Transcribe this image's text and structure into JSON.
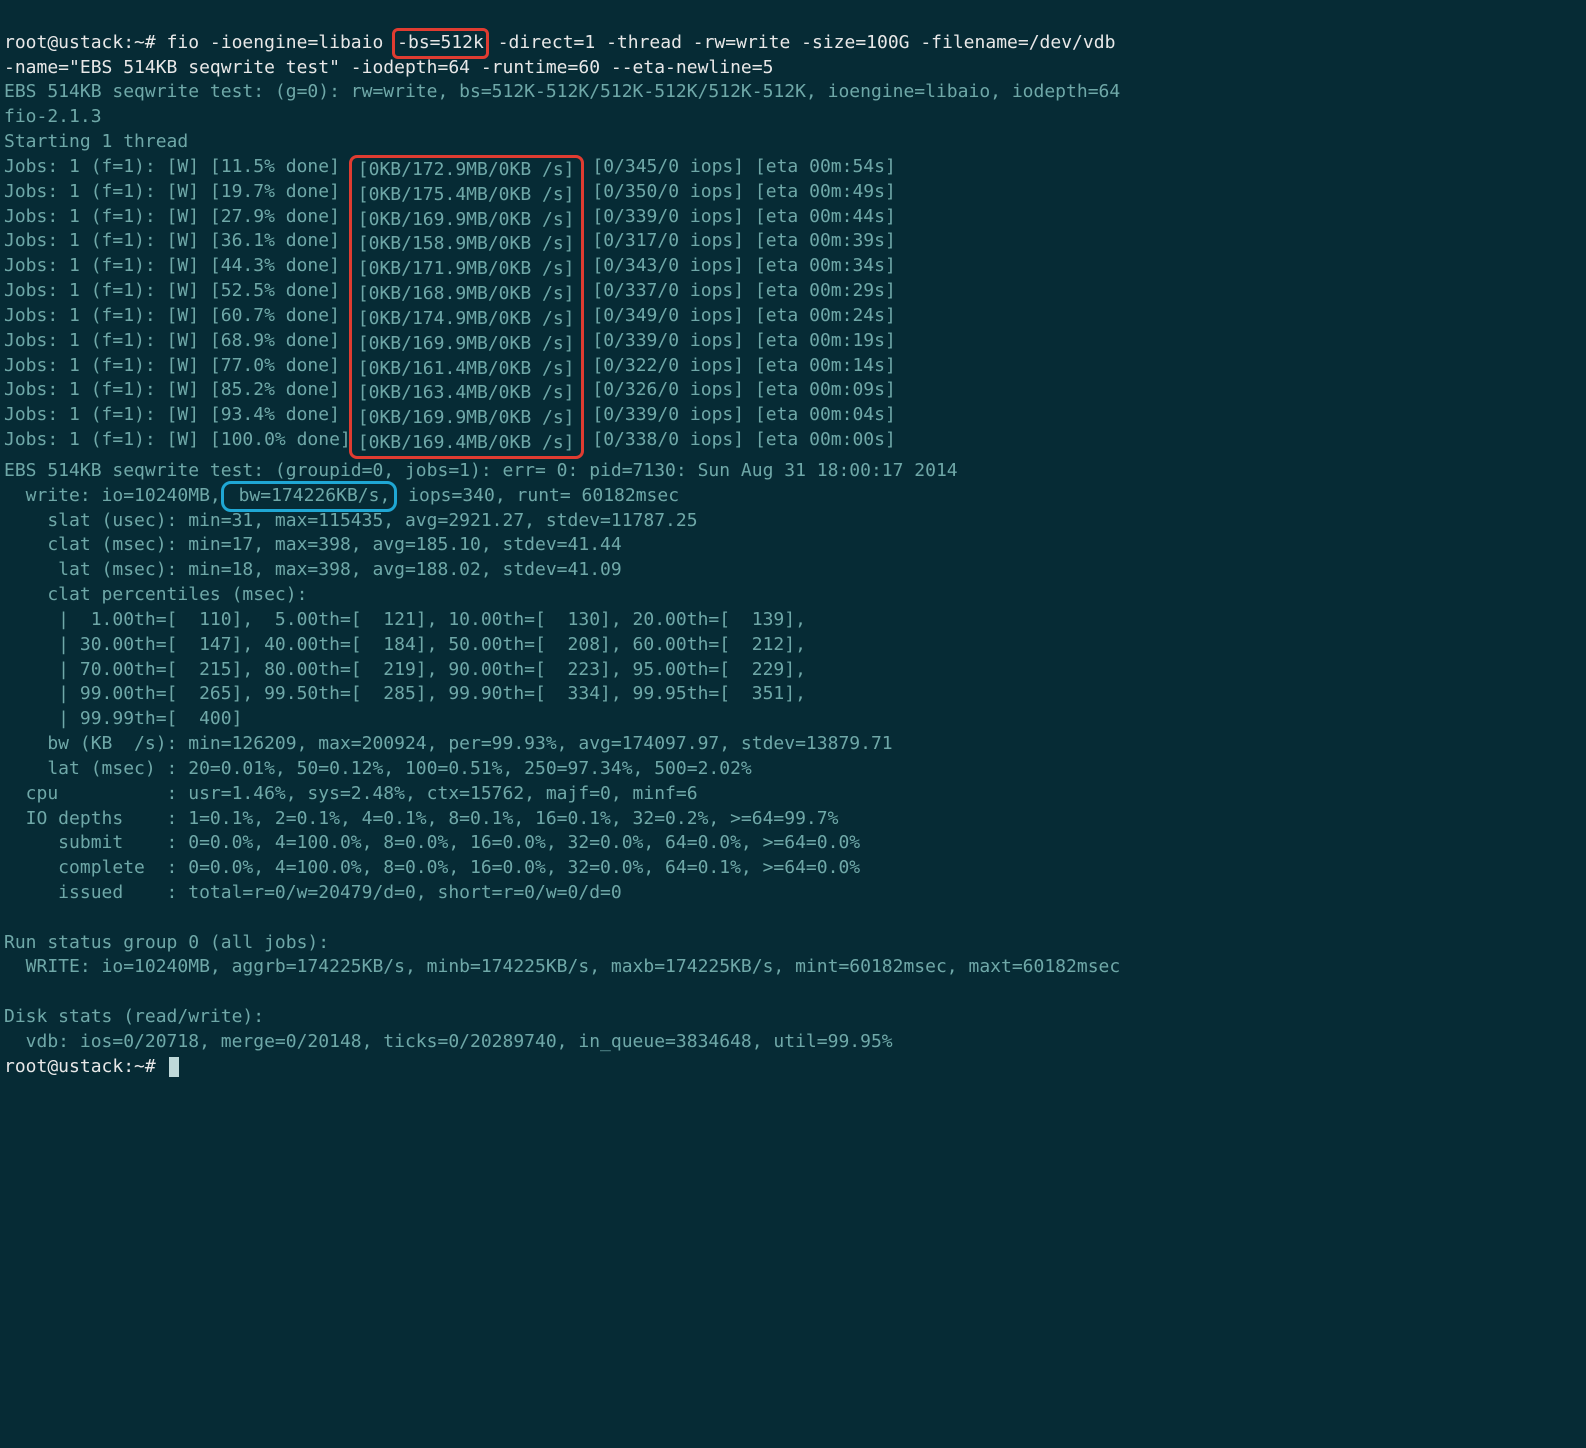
{
  "prompt1_user": "root@ustack",
  "prompt1_sep": ":~# ",
  "cmd_l1_a": "fio -ioengine=libaio ",
  "cmd_hl_bs": "-bs=512k",
  "cmd_l1_b": " -direct=1 -thread -rw=write -size=100G -filename=/dev/vdb",
  "cmd_l2": "-name=\"EBS 514KB seqwrite test\" -iodepth=64 -runtime=60 --eta-newline=5",
  "hdr1": "EBS 514KB seqwrite test: (g=0): rw=write, bs=512K-512K/512K-512K/512K-512K, ioengine=libaio, iodepth=64",
  "hdr2": "fio-2.1.3",
  "hdr3": "Starting 1 thread",
  "jobs": [
    {
      "left": "Jobs: 1 (f=1): [W] [11.5% done] ",
      "mid": "[0KB/172.9MB/0KB /s]",
      "right": " [0/345/0 iops] [eta 00m:54s]"
    },
    {
      "left": "Jobs: 1 (f=1): [W] [19.7% done] ",
      "mid": "[0KB/175.4MB/0KB /s]",
      "right": " [0/350/0 iops] [eta 00m:49s]"
    },
    {
      "left": "Jobs: 1 (f=1): [W] [27.9% done] ",
      "mid": "[0KB/169.9MB/0KB /s]",
      "right": " [0/339/0 iops] [eta 00m:44s]"
    },
    {
      "left": "Jobs: 1 (f=1): [W] [36.1% done] ",
      "mid": "[0KB/158.9MB/0KB /s]",
      "right": " [0/317/0 iops] [eta 00m:39s]"
    },
    {
      "left": "Jobs: 1 (f=1): [W] [44.3% done] ",
      "mid": "[0KB/171.9MB/0KB /s]",
      "right": " [0/343/0 iops] [eta 00m:34s]"
    },
    {
      "left": "Jobs: 1 (f=1): [W] [52.5% done] ",
      "mid": "[0KB/168.9MB/0KB /s]",
      "right": " [0/337/0 iops] [eta 00m:29s]"
    },
    {
      "left": "Jobs: 1 (f=1): [W] [60.7% done] ",
      "mid": "[0KB/174.9MB/0KB /s]",
      "right": " [0/349/0 iops] [eta 00m:24s]"
    },
    {
      "left": "Jobs: 1 (f=1): [W] [68.9% done] ",
      "mid": "[0KB/169.9MB/0KB /s]",
      "right": " [0/339/0 iops] [eta 00m:19s]"
    },
    {
      "left": "Jobs: 1 (f=1): [W] [77.0% done] ",
      "mid": "[0KB/161.4MB/0KB /s]",
      "right": " [0/322/0 iops] [eta 00m:14s]"
    },
    {
      "left": "Jobs: 1 (f=1): [W] [85.2% done] ",
      "mid": "[0KB/163.4MB/0KB /s]",
      "right": " [0/326/0 iops] [eta 00m:09s]"
    },
    {
      "left": "Jobs: 1 (f=1): [W] [93.4% done] ",
      "mid": "[0KB/169.9MB/0KB /s]",
      "right": " [0/339/0 iops] [eta 00m:04s]"
    },
    {
      "left": "Jobs: 1 (f=1): [W] [100.0% done]",
      "mid": "[0KB/169.4MB/0KB /s]",
      "right": " [0/338/0 iops] [eta 00m:00s]"
    }
  ],
  "result_hdr": "EBS 514KB seqwrite test: (groupid=0, jobs=1): err= 0: pid=7130: Sun Aug 31 18:00:17 2014",
  "write_a": "  write: io=10240MB,",
  "write_hl": " bw=174226KB/s,",
  "write_b": " iops=340, runt= 60182msec",
  "slat": "    slat (usec): min=31, max=115435, avg=2921.27, stdev=11787.25",
  "clat": "    clat (msec): min=17, max=398, avg=185.10, stdev=41.44",
  "lat": "     lat (msec): min=18, max=398, avg=188.02, stdev=41.09",
  "pct_hdr": "    clat percentiles (msec):",
  "pct1": "     |  1.00th=[  110],  5.00th=[  121], 10.00th=[  130], 20.00th=[  139],",
  "pct2": "     | 30.00th=[  147], 40.00th=[  184], 50.00th=[  208], 60.00th=[  212],",
  "pct3": "     | 70.00th=[  215], 80.00th=[  219], 90.00th=[  223], 95.00th=[  229],",
  "pct4": "     | 99.00th=[  265], 99.50th=[  285], 99.90th=[  334], 99.95th=[  351],",
  "pct5": "     | 99.99th=[  400]",
  "bw": "    bw (KB  /s): min=126209, max=200924, per=99.93%, avg=174097.97, stdev=13879.71",
  "lat2": "    lat (msec) : 20=0.01%, 50=0.12%, 100=0.51%, 250=97.34%, 500=2.02%",
  "cpu": "  cpu          : usr=1.46%, sys=2.48%, ctx=15762, majf=0, minf=6",
  "iod": "  IO depths    : 1=0.1%, 2=0.1%, 4=0.1%, 8=0.1%, 16=0.1%, 32=0.2%, >=64=99.7%",
  "sub": "     submit    : 0=0.0%, 4=100.0%, 8=0.0%, 16=0.0%, 32=0.0%, 64=0.0%, >=64=0.0%",
  "comp": "     complete  : 0=0.0%, 4=100.0%, 8=0.0%, 16=0.0%, 32=0.0%, 64=0.1%, >=64=0.0%",
  "iss": "     issued    : total=r=0/w=20479/d=0, short=r=0/w=0/d=0",
  "rsg": "Run status group 0 (all jobs):",
  "wrt": "  WRITE: io=10240MB, aggrb=174225KB/s, minb=174225KB/s, maxb=174225KB/s, mint=60182msec, maxt=60182msec",
  "ds": "Disk stats (read/write):",
  "vdb": "  vdb: ios=0/20718, merge=0/20148, ticks=0/20289740, in_queue=3834648, util=99.95%",
  "prompt2_user": "root@ustack",
  "prompt2_sep": ":~# "
}
